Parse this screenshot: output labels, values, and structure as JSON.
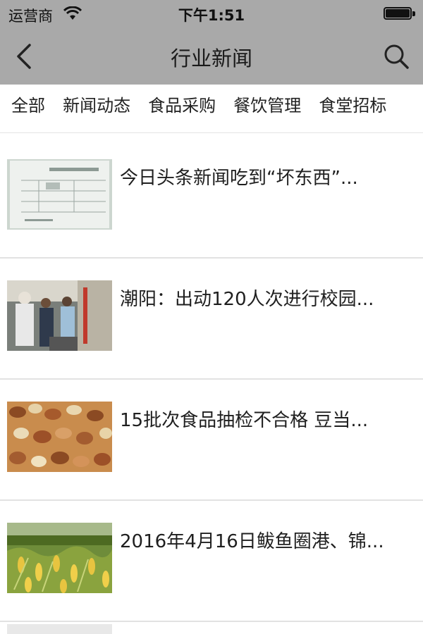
{
  "status_bar": {
    "carrier": "运营商",
    "time": "下午1:51"
  },
  "nav": {
    "title": "行业新闻",
    "back_icon": "chevron-left-icon",
    "search_icon": "search-icon"
  },
  "tabs": [
    {
      "label": "全部"
    },
    {
      "label": "新闻动态"
    },
    {
      "label": "食品采购"
    },
    {
      "label": "餐饮管理"
    },
    {
      "label": "食堂招标"
    }
  ],
  "news": [
    {
      "title": "今日头条新闻吃到“坏东西”...",
      "thumb": "document-photo"
    },
    {
      "title": "潮阳：出动120人次进行校园...",
      "thumb": "inspection-photo"
    },
    {
      "title": "15批次食品抽检不合格 豆当...",
      "thumb": "nuts-photo"
    },
    {
      "title": "2016年4月16日鲅鱼圈港、锦...",
      "thumb": "corn-field-photo"
    }
  ],
  "colors": {
    "header": "#a9a9a9",
    "divider": "#e2e2e2",
    "text": "#1f1f1f"
  }
}
